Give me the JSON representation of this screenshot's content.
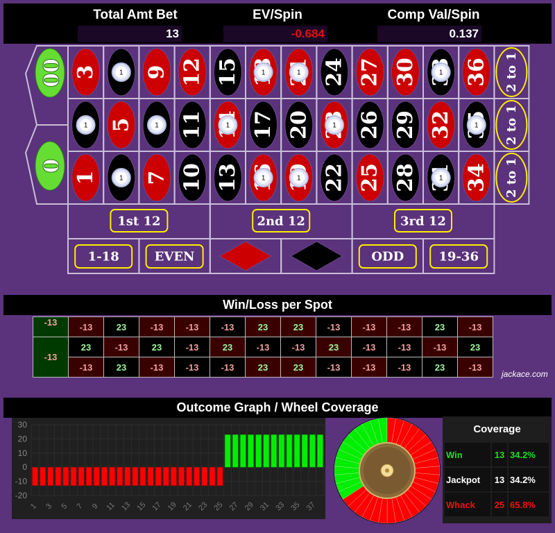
{
  "header": {
    "total_bet_label": "Total Amt Bet",
    "total_bet_value": "13",
    "ev_label": "EV/Spin",
    "ev_value": "-0.684",
    "comp_label": "Comp Val/Spin",
    "comp_value": "0.137"
  },
  "board": {
    "zeros": [
      "00",
      "0"
    ],
    "rows": [
      [
        3,
        6,
        9,
        12,
        15,
        18,
        21,
        24,
        27,
        30,
        33,
        36
      ],
      [
        2,
        5,
        8,
        11,
        14,
        17,
        20,
        23,
        26,
        29,
        32,
        35
      ],
      [
        1,
        4,
        7,
        10,
        13,
        16,
        19,
        22,
        25,
        28,
        31,
        34
      ]
    ],
    "red_numbers": [
      1,
      3,
      5,
      7,
      9,
      12,
      14,
      16,
      18,
      19,
      21,
      23,
      25,
      27,
      30,
      32,
      34,
      36
    ],
    "chip_numbers": [
      2,
      4,
      6,
      8,
      14,
      16,
      18,
      19,
      21,
      23,
      31,
      33,
      35
    ],
    "chip_value": "1",
    "column_label": "2 to 1",
    "dozens": [
      "1st 12",
      "2nd 12",
      "3rd 12"
    ],
    "outside": [
      "1-18",
      "EVEN",
      "red-diamond",
      "black-diamond",
      "ODD",
      "19-36"
    ]
  },
  "winloss": {
    "title": "Win/Loss per Spot",
    "zero_values": [
      "-13",
      "-13"
    ],
    "rows": [
      [
        "-13",
        "23",
        "-13",
        "-13",
        "-13",
        "23",
        "23",
        "-13",
        "-13",
        "-13",
        "23",
        "-13"
      ],
      [
        "23",
        "-13",
        "23",
        "-13",
        "23",
        "-13",
        "-13",
        "23",
        "-13",
        "-13",
        "-13",
        "23"
      ],
      [
        "-13",
        "23",
        "-13",
        "-13",
        "-13",
        "23",
        "23",
        "-13",
        "-13",
        "-13",
        "23",
        "-13"
      ]
    ],
    "credit": "jackace.com"
  },
  "outcome": {
    "title": "Outcome Graph / Wheel Coverage"
  },
  "chart_data": {
    "type": "bar",
    "title": "Outcome Graph",
    "categories": [
      "1",
      "2",
      "3",
      "4",
      "5",
      "6",
      "7",
      "8",
      "9",
      "10",
      "11",
      "12",
      "13",
      "14",
      "15",
      "16",
      "17",
      "18",
      "19",
      "20",
      "21",
      "22",
      "23",
      "24",
      "25",
      "26",
      "27",
      "28",
      "29",
      "30",
      "31",
      "32",
      "33",
      "34",
      "35",
      "36",
      "37",
      "38"
    ],
    "tick_labels": [
      "1",
      "3",
      "5",
      "7",
      "9",
      "11",
      "13",
      "15",
      "17",
      "19",
      "21",
      "23",
      "25",
      "27",
      "29",
      "31",
      "33",
      "35",
      "37"
    ],
    "values": [
      -13,
      -13,
      -13,
      -13,
      -13,
      -13,
      -13,
      -13,
      -13,
      -13,
      -13,
      -13,
      -13,
      -13,
      -13,
      -13,
      -13,
      -13,
      -13,
      -13,
      -13,
      -13,
      -13,
      -13,
      -13,
      23,
      23,
      23,
      23,
      23,
      23,
      23,
      23,
      23,
      23,
      23,
      23,
      23
    ],
    "ylim": [
      -20,
      30
    ],
    "yticks": [
      30,
      20,
      10,
      0,
      -10,
      -20
    ],
    "grid": true,
    "colors": {
      "win": "#00ee00",
      "loss": "#ff0000"
    }
  },
  "wheel": {
    "win_pockets": 13,
    "total_pockets": 38,
    "win_color": "#00ee00",
    "loss_color": "#ff0000"
  },
  "coverage": {
    "title": "Coverage",
    "rows": [
      {
        "label": "Win",
        "count": "13",
        "pct": "34.2%",
        "color": "#22dd22"
      },
      {
        "label": "Jackpot",
        "count": "13",
        "pct": "34.2%",
        "color": "#ffffff"
      },
      {
        "label": "Whack",
        "count": "25",
        "pct": "65.8%",
        "color": "#ee1111"
      }
    ]
  }
}
